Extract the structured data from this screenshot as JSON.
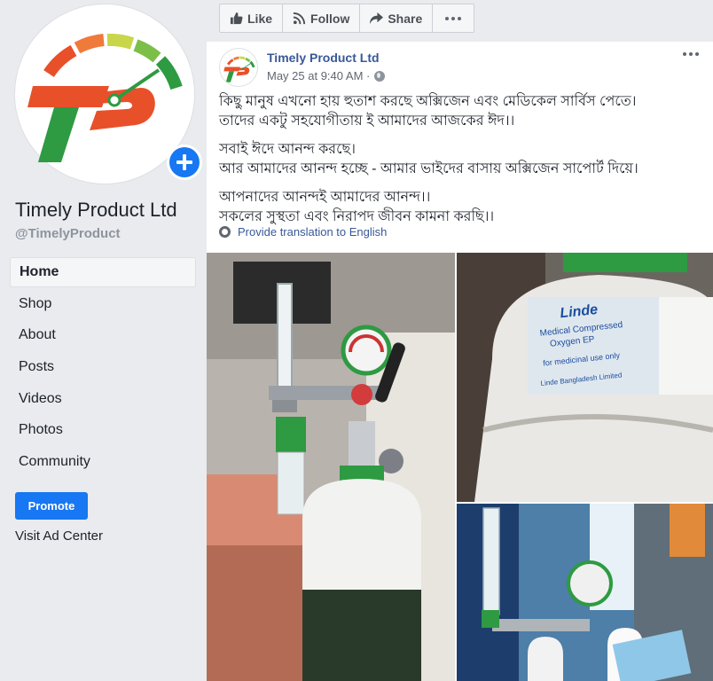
{
  "page": {
    "name": "Timely Product Ltd",
    "handle": "@TimelyProduct"
  },
  "nav": [
    {
      "label": "Home",
      "active": true
    },
    {
      "label": "Shop"
    },
    {
      "label": "About"
    },
    {
      "label": "Posts"
    },
    {
      "label": "Videos"
    },
    {
      "label": "Photos"
    },
    {
      "label": "Community"
    }
  ],
  "promote_label": "Promote",
  "visit_ad_label": "Visit Ad Center",
  "actions": {
    "like": "Like",
    "follow": "Follow",
    "share": "Share"
  },
  "post": {
    "author": "Timely Product Ltd",
    "timestamp": "May 25 at 9:40 AM · ",
    "paragraphs": [
      [
        "কিছু মানুষ এখনো হায় হুতাশ করছে অক্সিজেন এবং মেডিকেল সার্বিস পেতে।",
        "তাদের একটু সহযোগীতায় ই আমাদের আজকের ঈদ।।"
      ],
      [
        "সবাই ঈদে আনন্দ করছে।",
        "আর আমাদের আনন্দ হচ্ছে - আমার ভাইদের বাসায় অক্সিজেন সাপোর্ট দিয়ে।"
      ],
      [
        "আপনাদের আনন্দই আমাদের আনন্দ।।",
        "সকলের সুস্থতা এবং নিরাপদ জীবন কামনা করছি।।"
      ]
    ],
    "translate_label": "Provide translation to English"
  },
  "photo_text": {
    "brand": "Linde",
    "line1": "Medical Compressed",
    "line2": "Oxygen EP",
    "line3": "for medicinal use only",
    "line4": "Linde Bangladesh Limited"
  },
  "colors": {
    "brand_red": "#e8502a",
    "brand_green": "#2e9a42",
    "accent_blue": "#1877f2",
    "link_blue": "#385898"
  }
}
